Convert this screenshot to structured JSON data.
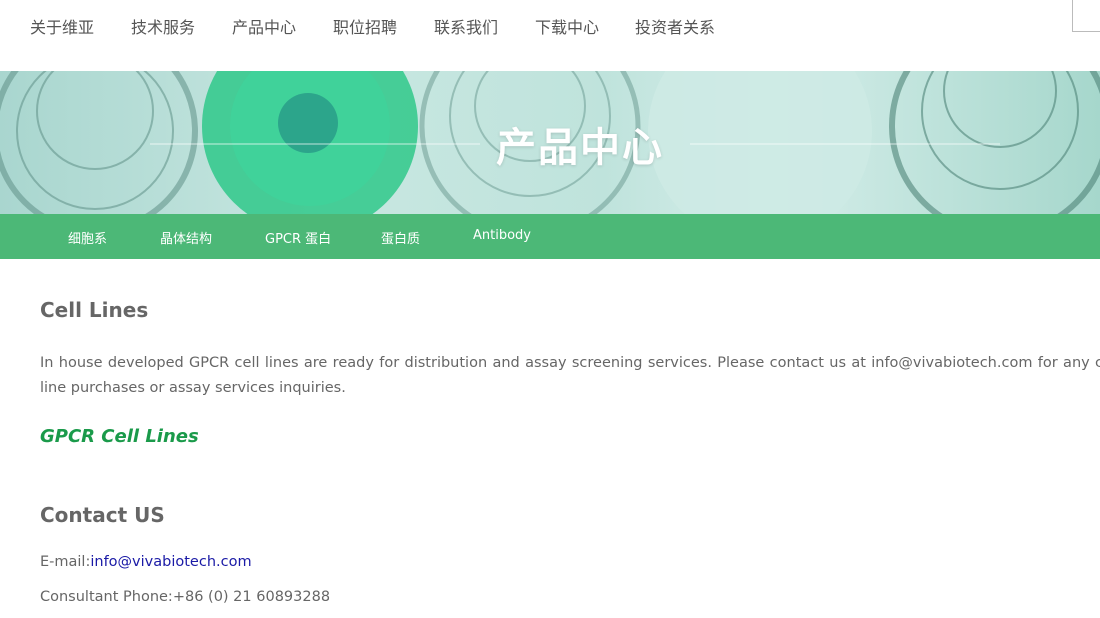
{
  "top_nav": {
    "items": [
      "关于维亚",
      "技术服务",
      "产品中心",
      "职位招聘",
      "联系我们",
      "下载中心",
      "投资者关系"
    ]
  },
  "banner": {
    "title": "产品中心"
  },
  "sub_nav": {
    "items": [
      "细胞系",
      "晶体结构",
      "GPCR 蛋白",
      "蛋白质",
      "Antibody"
    ]
  },
  "main": {
    "cell_lines_heading": "Cell Lines",
    "cell_lines_text": "In house developed GPCR cell lines are ready for distribution and assay screening services. Please contact us at info@vivabiotech.com for any cell line purchases or assay services inquiries.",
    "gpcr_link": "GPCR Cell Lines",
    "contact_heading": "Contact US",
    "email_label": "E-mail:",
    "email_value": "info@vivabiotech.com",
    "phone_label": "Consultant Phone:",
    "phone_value": "+86 (0) 21 60893288"
  },
  "colors": {
    "accent_green": "#4cb877",
    "link_green": "#1a9a4a",
    "email_blue": "#1a1aa6"
  }
}
